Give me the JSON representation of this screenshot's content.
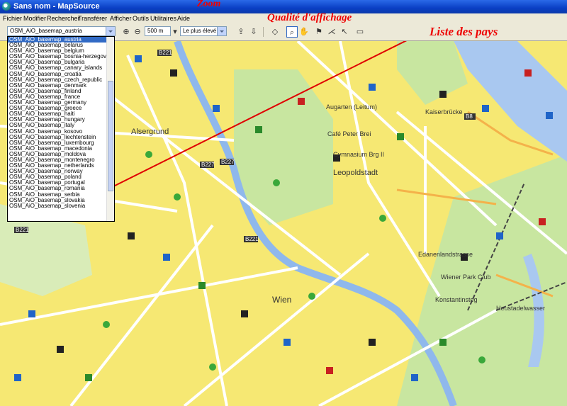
{
  "window": {
    "title": "Sans nom - MapSource"
  },
  "menu": [
    "Fichier",
    "Modifier",
    "Rechercher",
    "Transférer",
    "Afficher",
    "Outils",
    "Utilitaires",
    "Aide"
  ],
  "toolbar": {
    "map_combo_value": "OSM_AiO_basemap_austria",
    "zoom_value": "500 m",
    "quality_value": "Le plus élevé"
  },
  "country_list": [
    "OSM_AiO_basemap_austria",
    "OSM_AiO_basemap_belarus",
    "OSM_AiO_basemap_belgium",
    "OSM_AiO_basemap_bosnia-herzegovina",
    "OSM_AiO_basemap_bulgaria",
    "OSM_AiO_basemap_canary_islands",
    "OSM_AiO_basemap_croatia",
    "OSM_AiO_basemap_czech_republic",
    "OSM_AiO_basemap_denmark",
    "OSM_AiO_basemap_finland",
    "OSM_AiO_basemap_france",
    "OSM_AiO_basemap_germany",
    "OSM_AiO_basemap_greece",
    "OSM_AiO_basemap_haiti",
    "OSM_AiO_basemap_hungary",
    "OSM_AiO_basemap_italy",
    "OSM_AiO_basemap_kosovo",
    "OSM_AiO_basemap_liechtenstein",
    "OSM_AiO_basemap_luxembourg",
    "OSM_AiO_basemap_macedonia",
    "OSM_AiO_basemap_moldova",
    "OSM_AiO_basemap_montenegro",
    "OSM_AiO_basemap_netherlands",
    "OSM_AiO_basemap_norway",
    "OSM_AiO_basemap_poland",
    "OSM_AiO_basemap_portugal",
    "OSM_AiO_basemap_romania",
    "OSM_AiO_basemap_serbia",
    "OSM_AiO_basemap_slovakia",
    "OSM_AiO_basemap_slovenia"
  ],
  "selected_country_index": 0,
  "annotations": {
    "zoom": "Zoom",
    "quality": "Qualité d'affichage",
    "countries": "Liste des pays"
  },
  "places": [
    "Alsergrund",
    "Leopoldstadt",
    "Augarten (Leitum)",
    "Wien",
    "Edanenlandstrasse",
    "Wiener Park Club",
    "Konstantinsteg",
    "Heustadelwasser",
    "Café Peter Brei",
    "Gymnasium Brg II",
    "Kaiserbrücke"
  ],
  "road_labels": [
    "B221",
    "B227",
    "B8",
    "B221",
    "B227",
    "B221"
  ],
  "colors": {
    "map_bg": "#f6e873",
    "park": "#c8e6a0",
    "water": "#a9c8f0",
    "road": "#ffffff",
    "annotation": "#e00000"
  }
}
